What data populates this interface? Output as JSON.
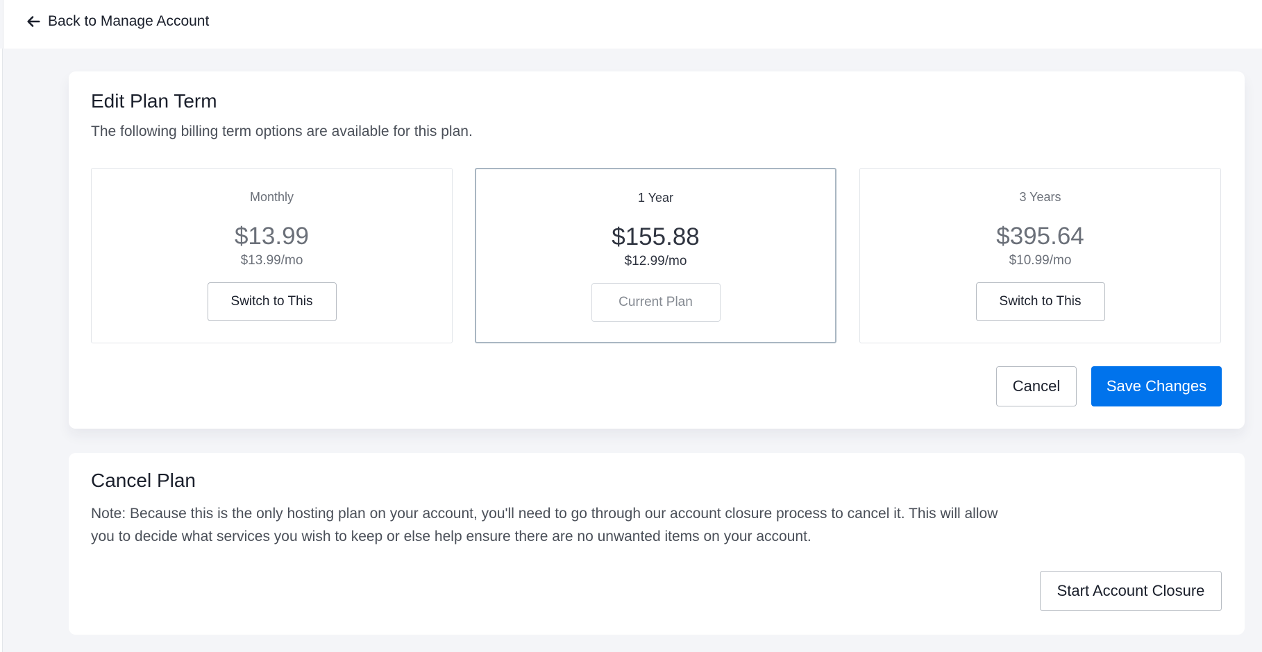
{
  "nav": {
    "back_label": "Back to Manage Account",
    "back_icon": "arrow-left-icon"
  },
  "edit_plan": {
    "title": "Edit Plan Term",
    "subtitle": "The following billing term options are available for this plan.",
    "options": [
      {
        "term": "Monthly",
        "price": "$13.99",
        "per_month": "$13.99/mo",
        "button": "Switch to This",
        "selected": false
      },
      {
        "term": "1 Year",
        "price": "$155.88",
        "per_month": "$12.99/mo",
        "button": "Current Plan",
        "selected": true
      },
      {
        "term": "3 Years",
        "price": "$395.64",
        "per_month": "$10.99/mo",
        "button": "Switch to This",
        "selected": false
      }
    ],
    "cancel_label": "Cancel",
    "save_label": "Save Changes"
  },
  "cancel_plan": {
    "title": "Cancel Plan",
    "note": "Note: Because this is the only hosting plan on your account, you'll need to go through our account closure process to cancel it. This will allow you to decide what services you wish to keep or else help ensure there are no unwanted items on your account.",
    "closure_label": "Start Account Closure"
  },
  "colors": {
    "primary": "#0073ec",
    "background": "#f4f5f8",
    "selected_border": "#a9b6c2"
  }
}
